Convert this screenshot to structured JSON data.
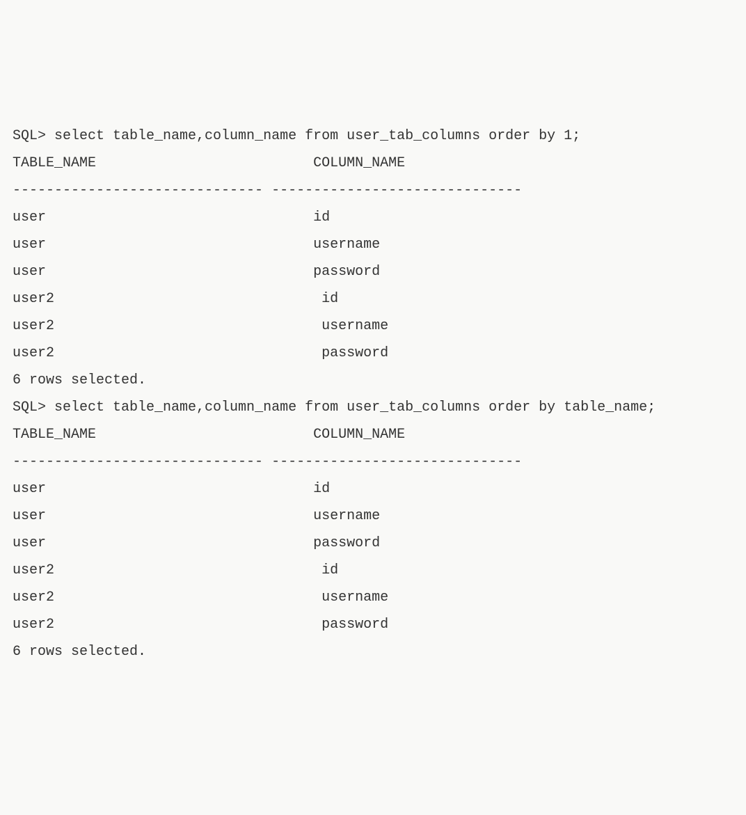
{
  "queries": [
    {
      "prompt": "SQL> ",
      "command": "select table_name,column_name from user_tab_columns order by 1;",
      "header_col1": "TABLE_NAME",
      "header_col2": "COLUMN_NAME",
      "sep_col1": "------------------------------",
      "sep_col2": "------------------------------",
      "rows": [
        {
          "c1": "user",
          "c2": "id",
          "pad": false
        },
        {
          "c1": "user",
          "c2": "username",
          "pad": false
        },
        {
          "c1": "user",
          "c2": "password",
          "pad": false
        },
        {
          "c1": "user2",
          "c2": "id",
          "pad": true
        },
        {
          "c1": "user2",
          "c2": "username",
          "pad": true
        },
        {
          "c1": "user2",
          "c2": "password",
          "pad": true
        }
      ],
      "footer": "6 rows selected."
    },
    {
      "prompt": "SQL> ",
      "command": "select table_name,column_name from user_tab_columns order by table_name;",
      "header_col1": "TABLE_NAME",
      "header_col2": "COLUMN_NAME",
      "sep_col1": "------------------------------",
      "sep_col2": "------------------------------",
      "rows": [
        {
          "c1": "user",
          "c2": "id",
          "pad": false
        },
        {
          "c1": "user",
          "c2": "username",
          "pad": false
        },
        {
          "c1": "user",
          "c2": "password",
          "pad": false
        },
        {
          "c1": "user2",
          "c2": "id",
          "pad": true
        },
        {
          "c1": "user2",
          "c2": "username",
          "pad": true
        },
        {
          "c1": "user2",
          "c2": "password",
          "pad": true
        }
      ],
      "footer": "6 rows selected."
    }
  ]
}
